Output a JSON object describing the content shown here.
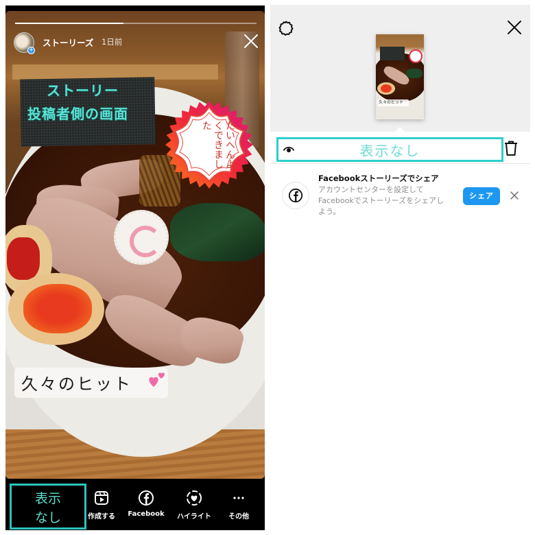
{
  "story_viewer": {
    "progress_fraction": 0.45,
    "username": "ストーリーズ",
    "posted_ago": "1日前",
    "annotation_line1": "ストーリー",
    "annotation_line2": "投稿者側の画面",
    "sticker_text": "たいへんよくできました",
    "caption": "久々のヒット",
    "highlight_label": "表示\nなし",
    "bottom_actions": [
      {
        "icon": "reels-create-icon",
        "label": "作成する"
      },
      {
        "icon": "facebook-icon",
        "label": "Facebook"
      },
      {
        "icon": "highlight-heart-icon",
        "label": "ハイライト"
      },
      {
        "icon": "more-dots-icon",
        "label": "その他"
      }
    ]
  },
  "viewer_sheet": {
    "thumb_caption": "久々のヒット",
    "views_label": "表示なし",
    "facebook_card": {
      "title": "Facebookストーリーズでシェア",
      "description": "アカウントセンターを設定してFacebookでストーリーズをシェアしよう。",
      "share_button": "シェア"
    }
  },
  "colors": {
    "highlight_cyan": "#2dc3bd",
    "share_blue": "#1d98f0"
  }
}
